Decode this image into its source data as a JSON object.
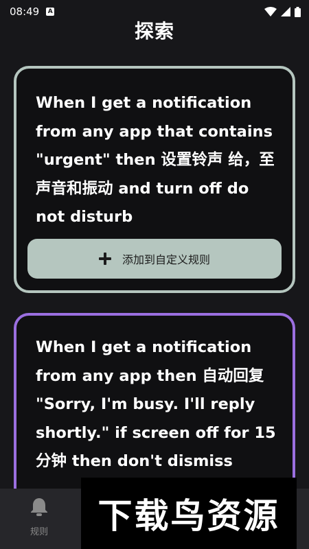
{
  "status_bar": {
    "time": "08:49",
    "notification_icon_glyph": "A",
    "icons": [
      "wifi-icon",
      "signal-icon",
      "battery-icon"
    ]
  },
  "header": {
    "title": "探索"
  },
  "cards": [
    {
      "text": "When I get a notification from any app that contains \"urgent\" then 设置铃声 给，至 声音和振动 and turn off do not disturb",
      "button_label": "添加到自定义规则",
      "border_color": "#b5c6bf"
    },
    {
      "text": "When I get a notification from any app then 自动回复 \"Sorry, I'm busy. I'll reply shortly.\" if screen off for 15 分钟 then don't dismiss",
      "border_color": "#9b6fe0"
    }
  ],
  "bottom_nav": {
    "items": [
      {
        "label": "规则",
        "icon": "bell-icon"
      }
    ]
  },
  "watermark": {
    "text": "下载鸟资源"
  },
  "colors": {
    "background": "#17171a",
    "card_background": "#101012",
    "accent_green": "#b5c6bf",
    "accent_purple": "#9b6fe0",
    "nav_background": "#26262a"
  }
}
